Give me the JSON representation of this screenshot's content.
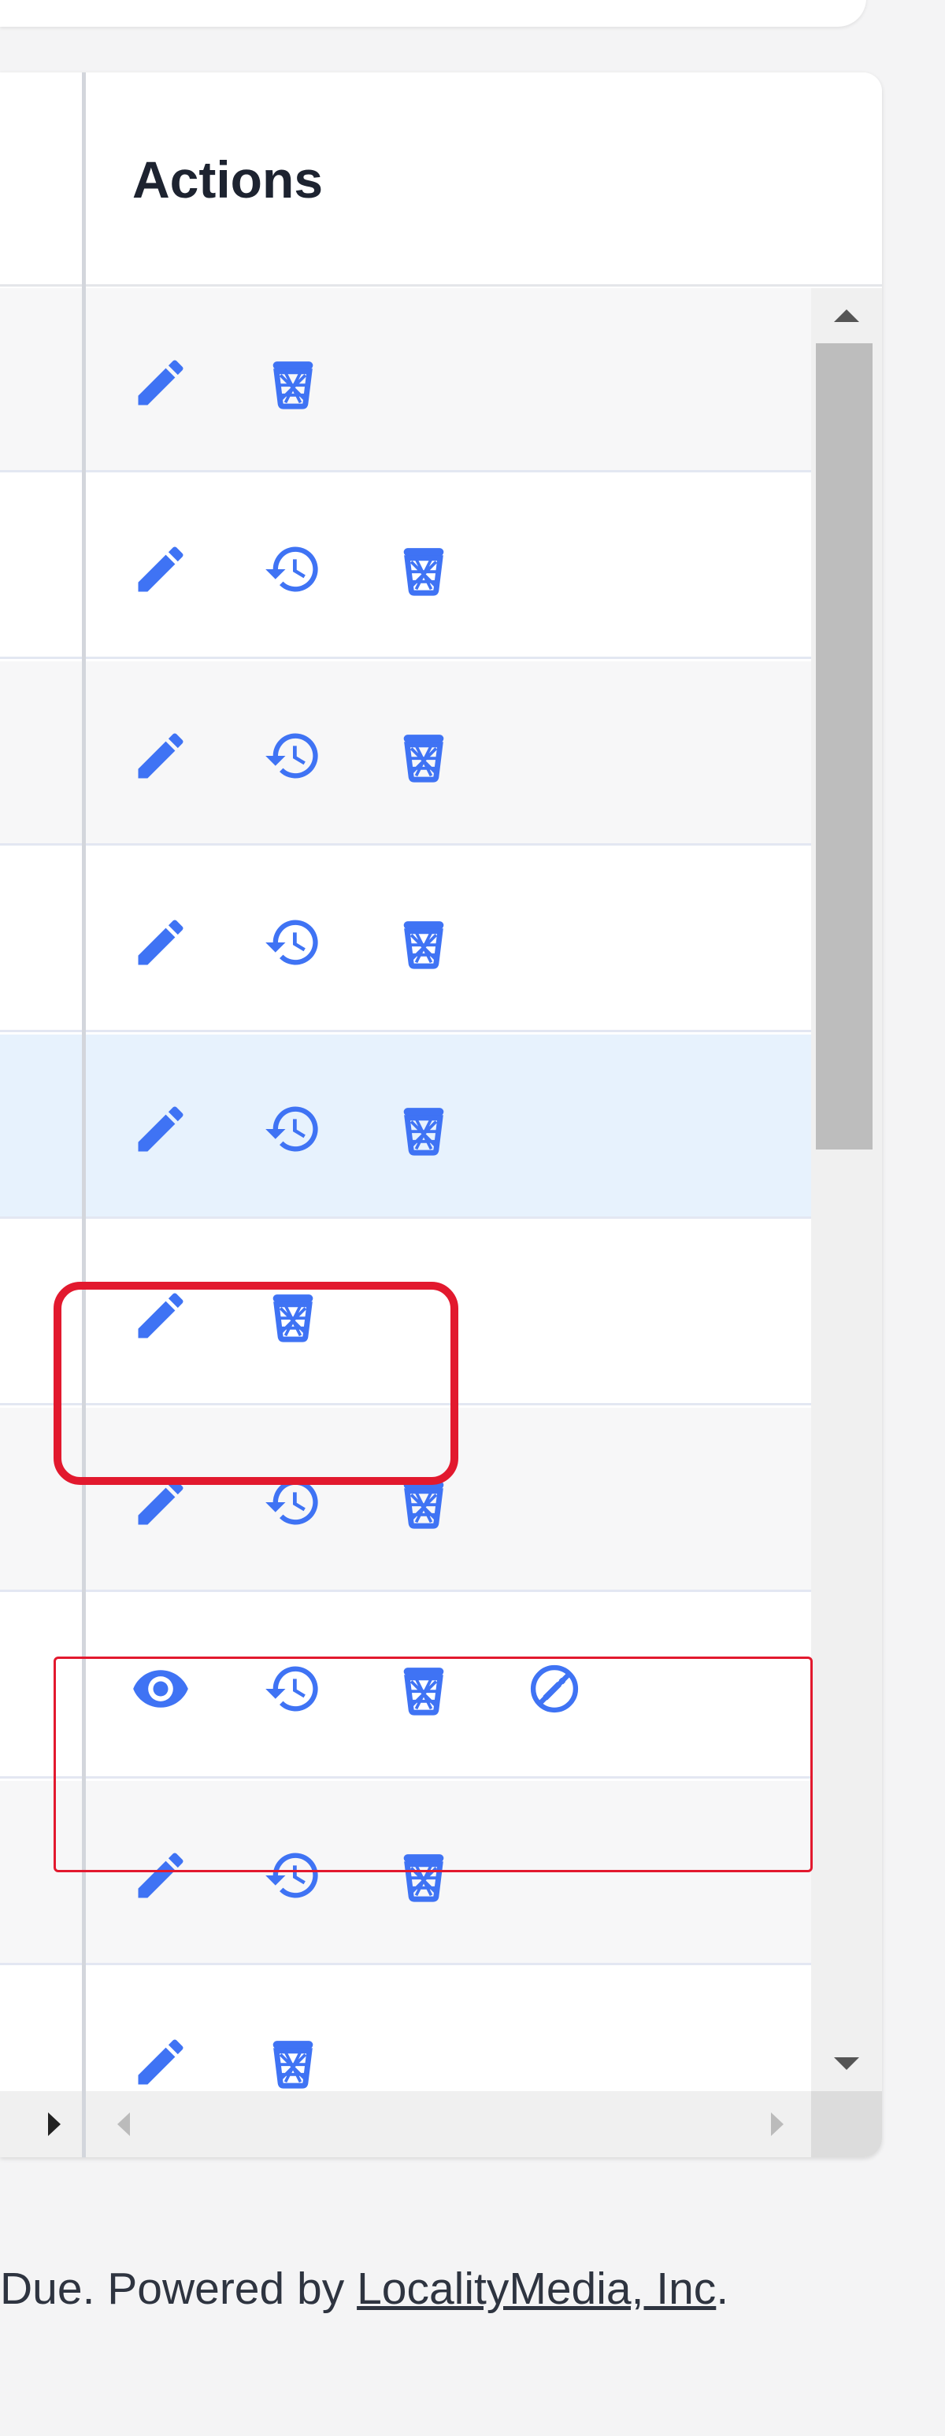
{
  "table": {
    "header": {
      "actions_label": "Actions"
    },
    "rows": [
      {
        "icons": [
          "pencil-icon",
          "trash-icon"
        ],
        "state": "odd"
      },
      {
        "icons": [
          "pencil-icon",
          "history-icon",
          "trash-icon"
        ],
        "state": "even"
      },
      {
        "icons": [
          "pencil-icon",
          "history-icon",
          "trash-icon"
        ],
        "state": "odd"
      },
      {
        "icons": [
          "pencil-icon",
          "history-icon",
          "trash-icon"
        ],
        "state": "even"
      },
      {
        "icons": [
          "pencil-icon",
          "history-icon",
          "trash-icon"
        ],
        "state": "hover"
      },
      {
        "icons": [
          "pencil-icon",
          "trash-icon"
        ],
        "state": "even",
        "highlight": "rounded"
      },
      {
        "icons": [
          "pencil-icon",
          "history-icon",
          "trash-icon"
        ],
        "state": "odd"
      },
      {
        "icons": [
          "eye-icon",
          "history-icon",
          "trash-icon",
          "edit-off-icon"
        ],
        "state": "even",
        "highlight": "rect"
      },
      {
        "icons": [
          "pencil-icon",
          "history-icon",
          "trash-icon"
        ],
        "state": "odd"
      },
      {
        "icons": [
          "pencil-icon",
          "trash-icon"
        ],
        "state": "even"
      }
    ]
  },
  "footer": {
    "prefix": "Due. Powered by ",
    "link_text": "LocalityMedia, Inc",
    "suffix": "."
  },
  "colors": {
    "icon_blue": "#3f73f4",
    "highlight_red": "#e2192e",
    "row_hover": "#e7f2fd",
    "row_stripe": "#f7f7f8",
    "header_text": "#1d2330"
  }
}
